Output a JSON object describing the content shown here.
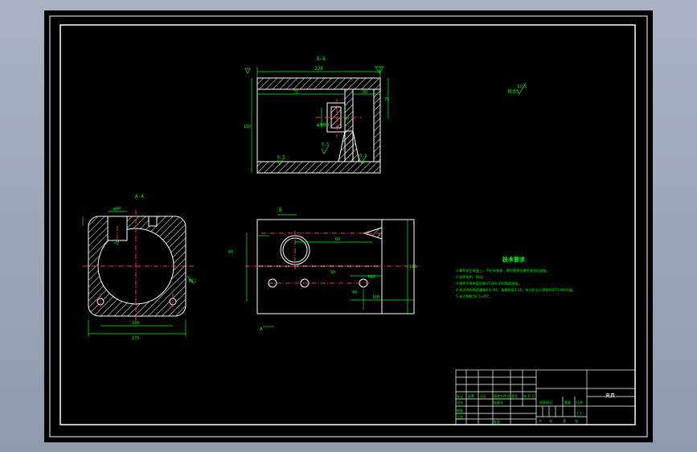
{
  "drawing": {
    "colors": {
      "background": "#000000",
      "outline": "#ffffff",
      "dimension": "#00ff00",
      "centerline": "#ff3333",
      "hatch": "#ffffff",
      "window_frame": "#9aa4b5"
    },
    "section_view": {
      "label": "B-B",
      "dims": [
        "220",
        "72",
        "80",
        "76",
        "150",
        "30",
        "φ30H8"
      ],
      "roughness": [
        "6.3",
        "6.3",
        "6.3"
      ]
    },
    "side_view": {
      "label": "A-A",
      "dims": [
        "φ40",
        "20",
        "170",
        "150",
        "M12"
      ]
    },
    "front_view": {
      "cut_label_top": "B",
      "cut_label_bottom": "A",
      "dims": [
        "80",
        "116",
        "60",
        "M10",
        "90",
        "40",
        "100"
      ]
    },
    "roughness_general": {
      "value": "12.5",
      "note": "其余"
    },
    "tech_requirements": {
      "title": "技术要求",
      "items": [
        "1.零件加工表面上，不应有划痕、擦伤等损伤零件表面的缺陷。",
        "2.去除毛刺、锐边。",
        "3.铸件不得有裂纹和HT200-300铸造缺陷。",
        "4.未注明的铸造圆角R3~R5，拔模斜度1:20，未注形位公差按GB/T1184-K级。",
        "5.未注倒角为C1×45°。"
      ]
    },
    "title_block": {
      "part_name": "夹具",
      "cells": [
        "标记",
        "处数",
        "分区",
        "更改文件号",
        "签名",
        "年 月 日",
        "设计",
        "标准化",
        "阶段标记",
        "重量",
        "比例",
        "审核",
        "工艺",
        "批准",
        "共",
        "张",
        "第",
        "张",
        "1:1"
      ]
    }
  }
}
